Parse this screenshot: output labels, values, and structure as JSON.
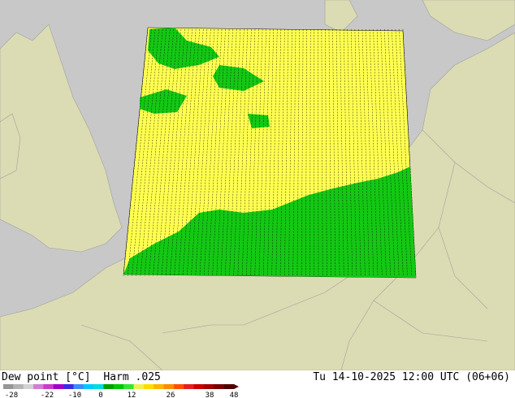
{
  "title": {
    "parameter": "Dew point [°C]",
    "model": "Harm .025"
  },
  "valid_time": "Tu 14-10-2025 12:00 UTC (06+06)",
  "legend": {
    "ticks": [
      "-28",
      "-22",
      "-10",
      "0",
      "12",
      "26",
      "38",
      "48"
    ],
    "colors": [
      "#969696",
      "#b4b4b4",
      "#d2d2d2",
      "#d27dd2",
      "#c83cc8",
      "#a000c8",
      "#3c28e6",
      "#3c8cff",
      "#00c8ff",
      "#00dcdc",
      "#00a000",
      "#00c800",
      "#32e632",
      "#f0f050",
      "#ffdc00",
      "#ffb400",
      "#ff8c00",
      "#ff5000",
      "#e61e1e",
      "#c80000",
      "#a00000",
      "#780000",
      "#500000"
    ]
  },
  "map_colors": {
    "sea": "#c8c8c8",
    "land": "#dcdcb4",
    "border": "#a0a0a0",
    "field_warm": "#ffff50",
    "field_cool": "#14c814"
  }
}
